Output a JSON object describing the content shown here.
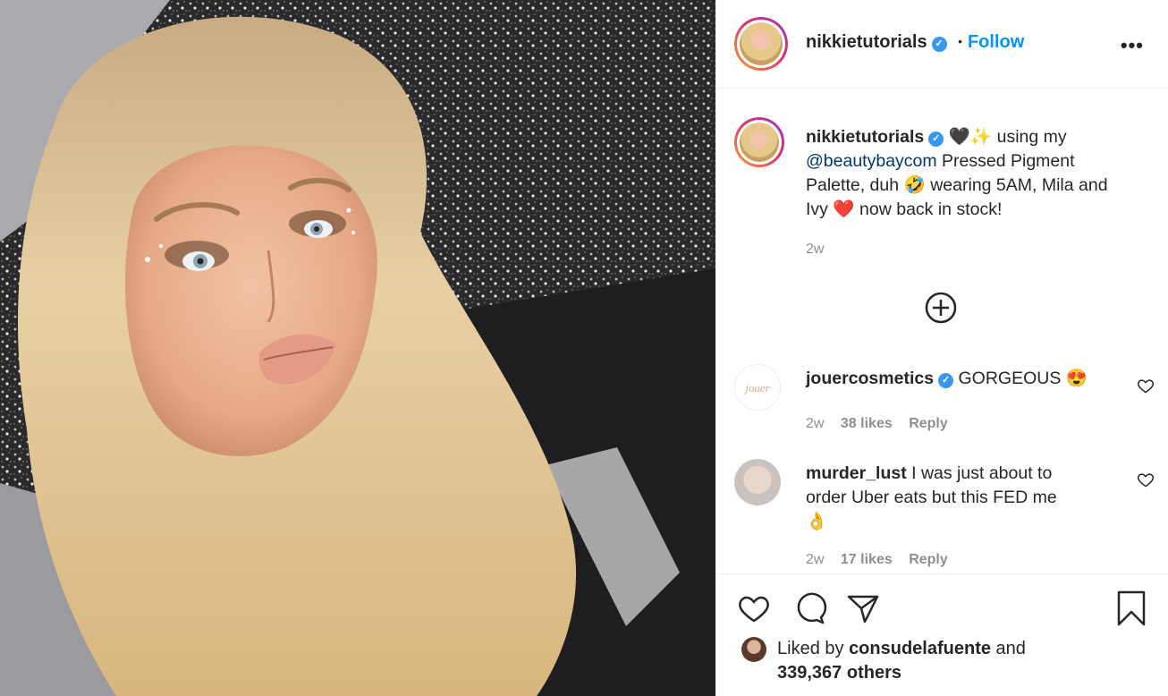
{
  "header": {
    "username": "nikkietutorials",
    "separator": "•",
    "follow_label": "Follow",
    "more_icon": "more-options-icon"
  },
  "caption": {
    "username": "nikkietutorials",
    "emoji_1": "🖤",
    "emoji_2": "✨",
    "text_1": "using my",
    "mention": "@beautybaycom",
    "text_2": "Pressed Pigment Palette, duh",
    "emoji_3": "🤣",
    "text_3": "wearing 5AM, Mila and Ivy",
    "emoji_4": "❤️",
    "text_4": "now back in stock!",
    "time": "2w"
  },
  "load_more_icon": "plus-circle-icon",
  "comments": [
    {
      "username": "jouercosmetics",
      "avatar_text": "jouer",
      "text": "GORGEOUS",
      "emoji": "😍",
      "time": "2w",
      "likes": "38 likes",
      "reply": "Reply"
    },
    {
      "username": "murder_lust",
      "text_line1": "I was just about to",
      "text_line2": "order Uber eats but this FED me",
      "emoji": "👌",
      "time": "2w",
      "likes": "17 likes",
      "reply": "Reply"
    }
  ],
  "actions": {
    "like_icon": "heart-icon",
    "comment_icon": "comment-icon",
    "share_icon": "paper-plane-icon",
    "save_icon": "bookmark-icon"
  },
  "likes": {
    "prefix": "Liked by",
    "user": "consudelafuente",
    "and": "and",
    "others": "339,367 others"
  },
  "colors": {
    "accent_blue": "#0095f6",
    "mention": "#00376b",
    "muted": "#8e8e8e",
    "text": "#262626",
    "divider": "#efefef"
  }
}
